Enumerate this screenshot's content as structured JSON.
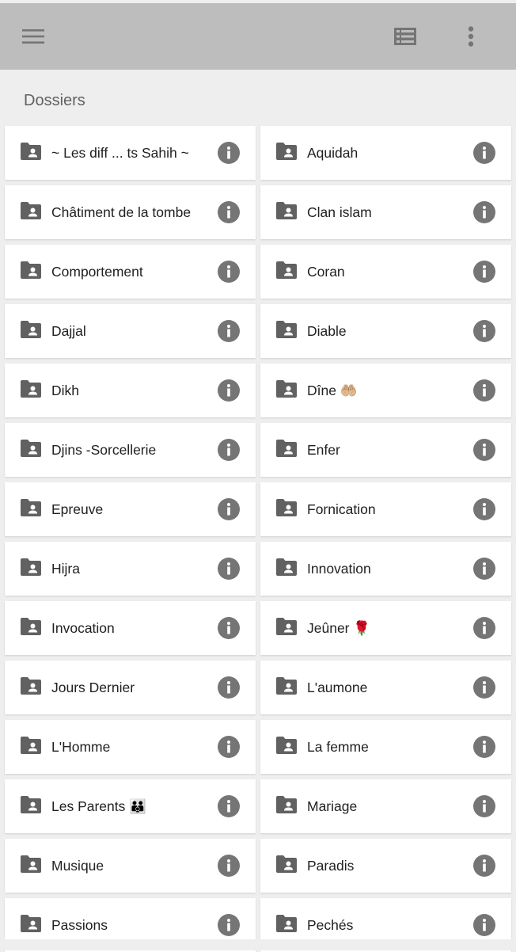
{
  "app_bar": {
    "menu_icon": "hamburger-menu-icon",
    "list_icon": "list-view-icon",
    "more_icon": "more-vert-icon"
  },
  "section": {
    "title": "Dossiers"
  },
  "folders": [
    {
      "name": "~ Les diff ... ts Sahih ~"
    },
    {
      "name": "Aquidah"
    },
    {
      "name": "Châtiment de la tombe"
    },
    {
      "name": "Clan islam"
    },
    {
      "name": "Comportement"
    },
    {
      "name": "Coran"
    },
    {
      "name": "Dajjal"
    },
    {
      "name": "Diable"
    },
    {
      "name": "Dikh"
    },
    {
      "name": "Dîne 🤲🏼"
    },
    {
      "name": "Djins -Sorcellerie"
    },
    {
      "name": "Enfer"
    },
    {
      "name": "Epreuve"
    },
    {
      "name": "Fornication"
    },
    {
      "name": "Hijra"
    },
    {
      "name": "Innovation"
    },
    {
      "name": "Invocation"
    },
    {
      "name": "Jeûner 🌹"
    },
    {
      "name": "Jours Dernier"
    },
    {
      "name": "L'aumone"
    },
    {
      "name": "L'Homme"
    },
    {
      "name": "La femme"
    },
    {
      "name": "Les Parents 👪"
    },
    {
      "name": "Mariage"
    },
    {
      "name": "Musique"
    },
    {
      "name": "Paradis"
    },
    {
      "name": "Passions"
    },
    {
      "name": "Pechés"
    }
  ],
  "colors": {
    "app_bar": "#bdbdbd",
    "background": "#eeeeee",
    "icon": "#616161",
    "card": "#ffffff"
  }
}
